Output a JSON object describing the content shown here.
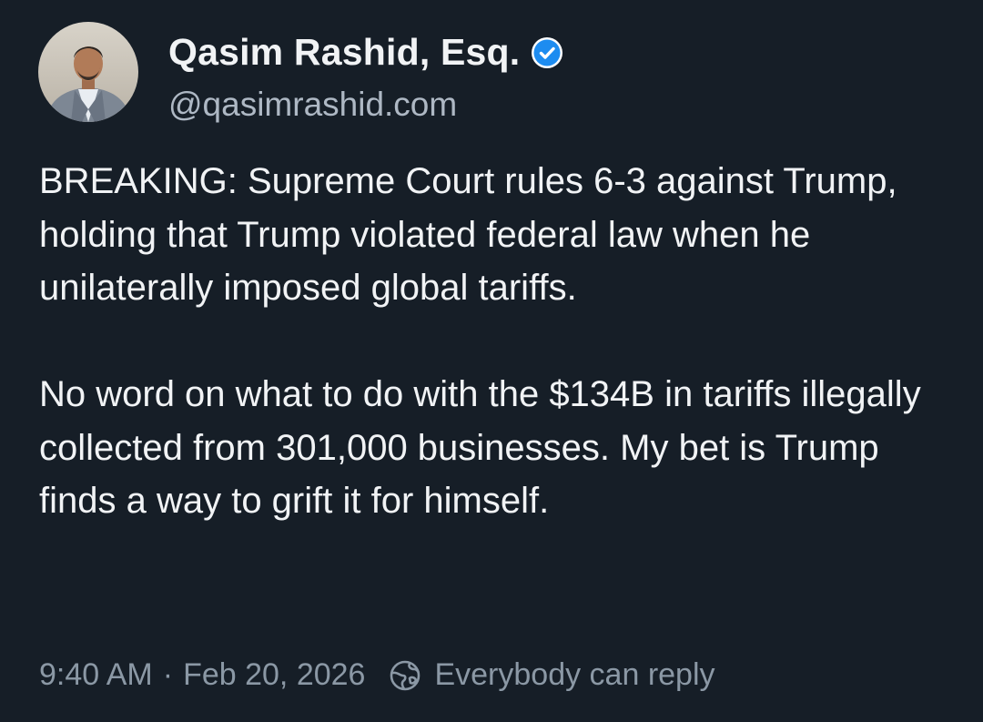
{
  "author": {
    "display_name": "Qasim Rashid, Esq.",
    "handle": "@qasimrashid.com",
    "verified_icon": "verified-badge-icon",
    "verified_color": "#1d8cf0"
  },
  "post": {
    "paragraphs": [
      "BREAKING: Supreme Court rules 6-3 against Trump, holding that Trump violated federal law when he unilaterally imposed global tariffs.",
      "No word on what to do with the $134B in tariffs illegally collected from 301,000 businesses. My bet is Trump finds a way to grift it for himself."
    ]
  },
  "meta": {
    "time": "9:40 AM",
    "separator": "·",
    "date": "Feb 20, 2026",
    "reply_setting_icon": "globe-icon",
    "reply_setting": "Everybody can reply"
  },
  "colors": {
    "background": "#161e27",
    "text": "#f1f3f5",
    "muted": "#8b98a5"
  }
}
